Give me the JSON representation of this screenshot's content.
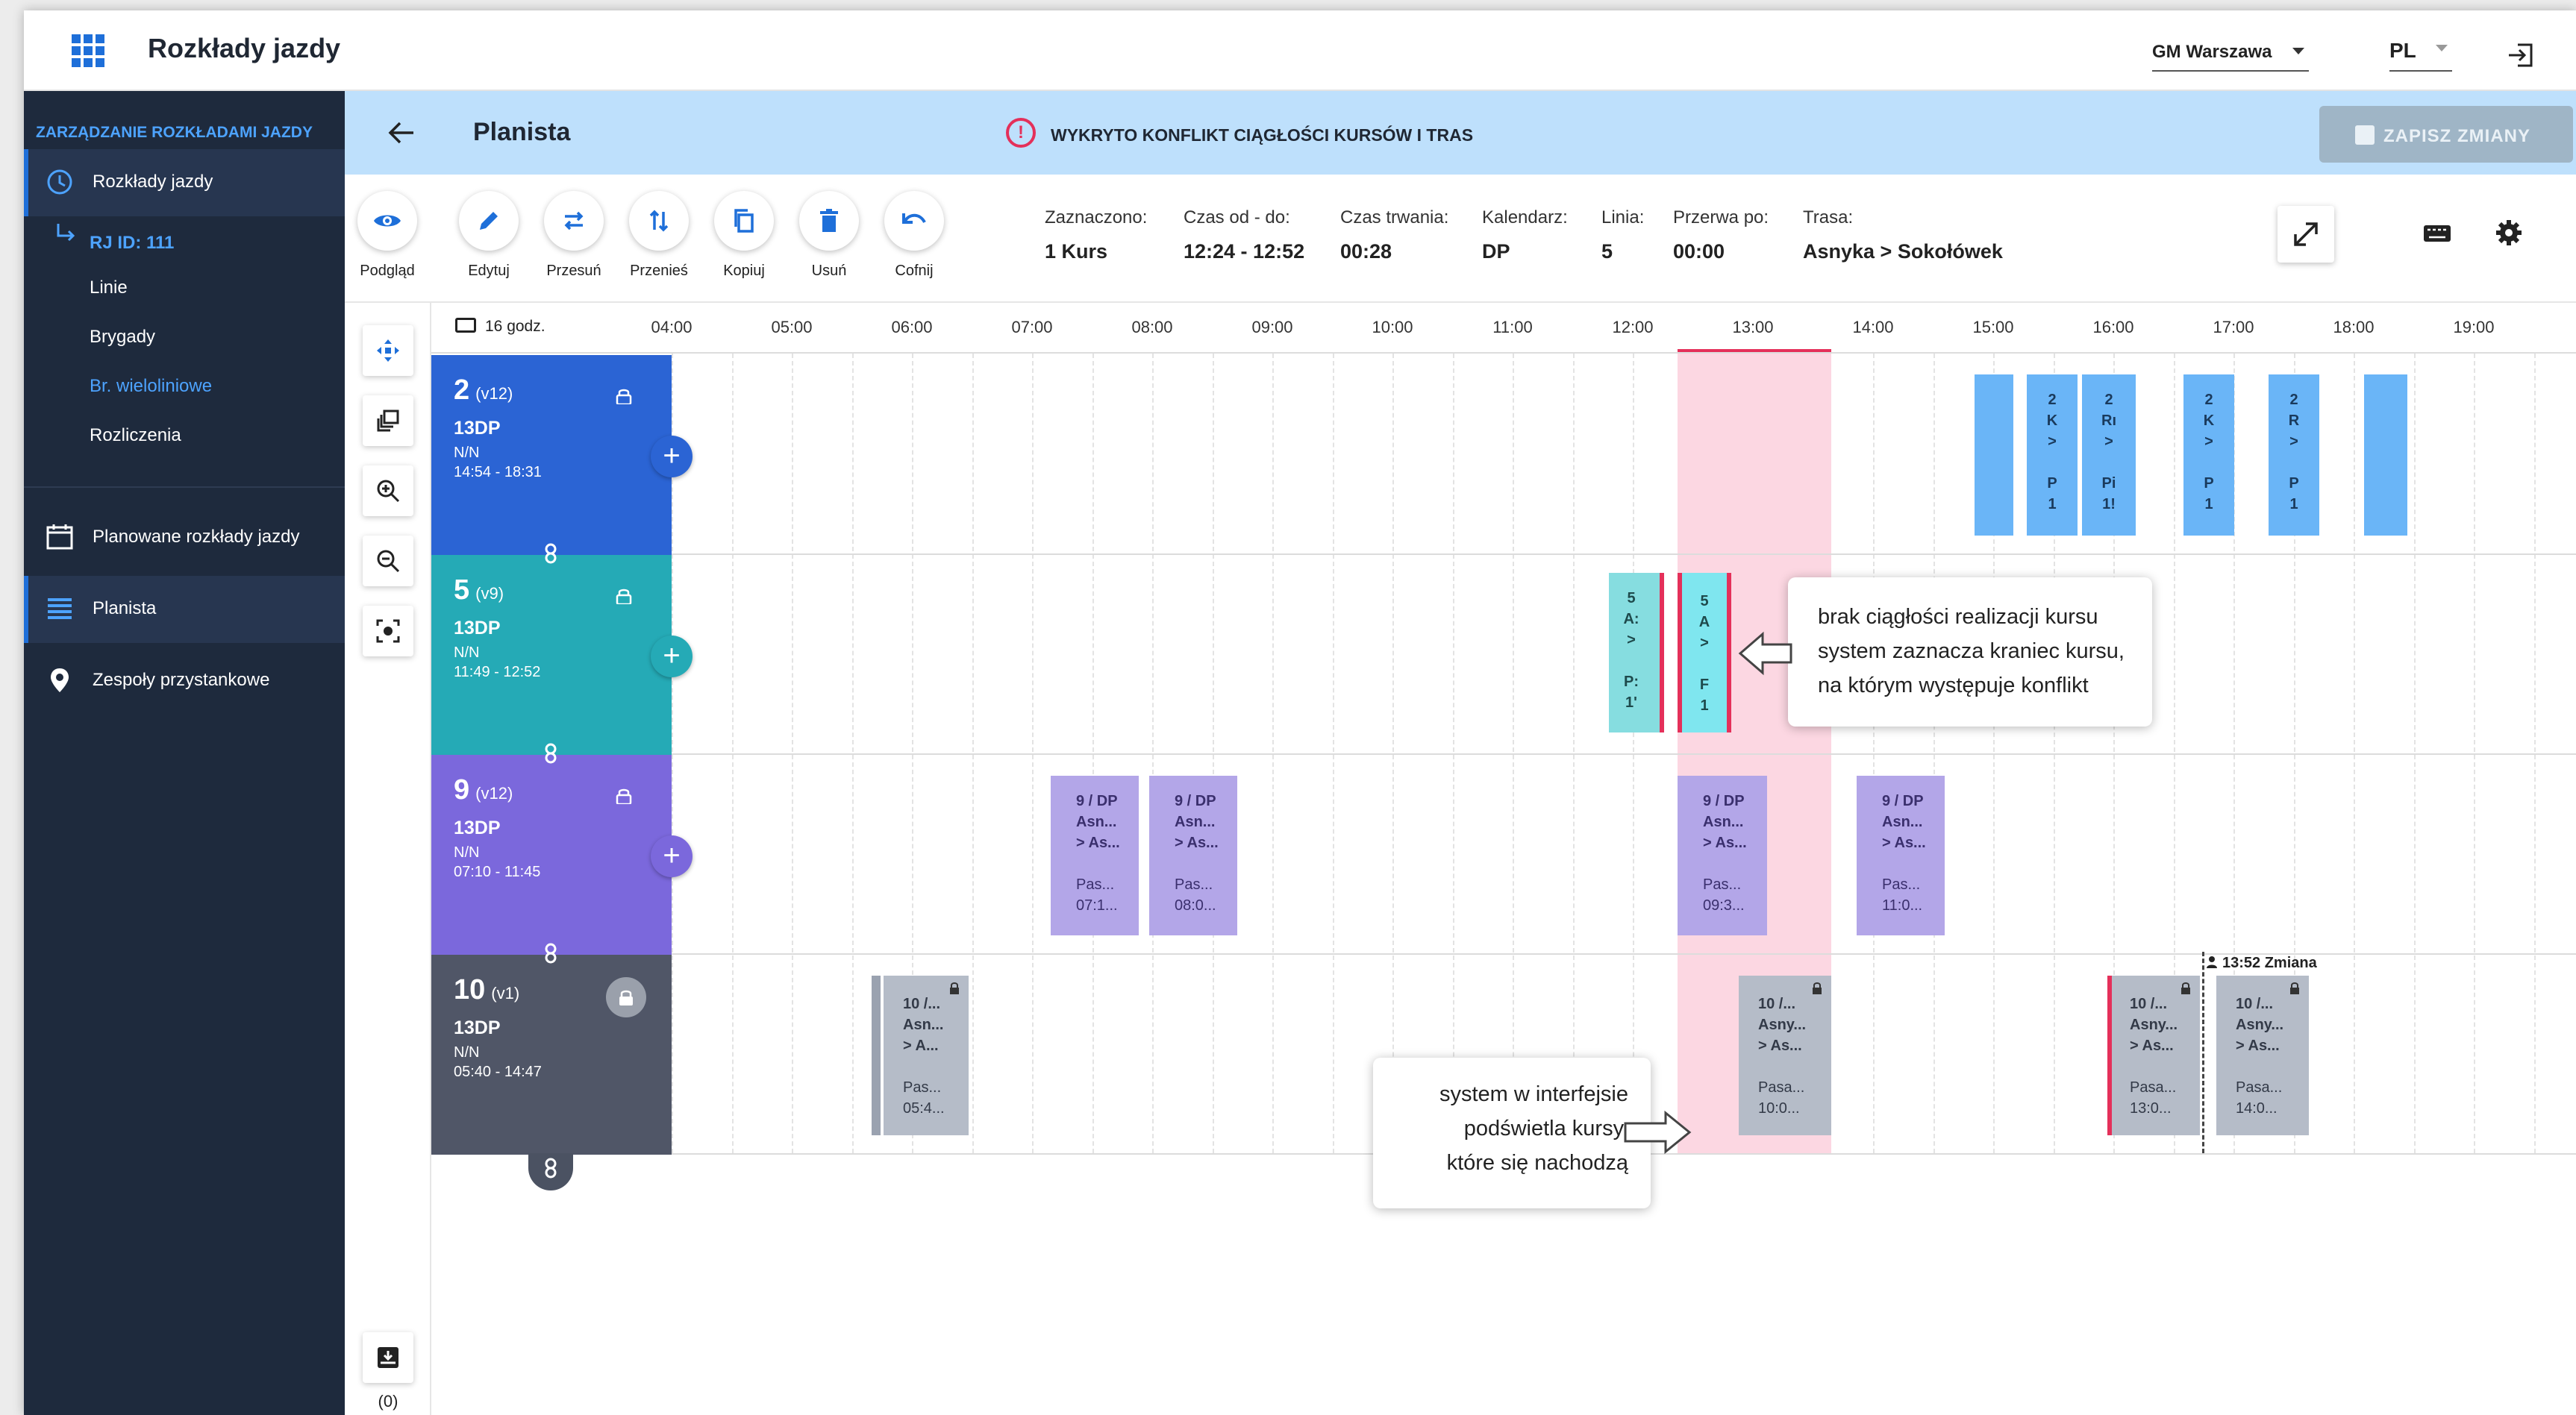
{
  "app": {
    "title": "Rozkłady jazdy"
  },
  "topbar": {
    "org": "GM Warszawa",
    "lang": "PL"
  },
  "sidebar": {
    "heading": "ZARZĄDZANIE ROZKŁADAMI JAZDY",
    "items": [
      {
        "label": "Rozkłady jazdy",
        "icon": "clock-icon"
      },
      {
        "label": "Planowane rozkłady jazdy",
        "icon": "calendar-icon"
      },
      {
        "label": "Planista",
        "icon": "planner-icon"
      },
      {
        "label": "Zespoły przystankowe",
        "icon": "pin-icon"
      }
    ],
    "rj": "RJ ID: 111",
    "subitems": [
      {
        "label": "Linie"
      },
      {
        "label": "Brygady"
      },
      {
        "label": "Br. wieloliniowe"
      },
      {
        "label": "Rozliczenia"
      }
    ]
  },
  "header": {
    "title": "Planista",
    "conflict": "WYKRYTO KONFLIKT CIĄGŁOŚCI KURSÓW I TRAS",
    "save": "ZAPISZ ZMIANY"
  },
  "toolbar": {
    "buttons": [
      {
        "label": "Podgląd",
        "icon": "eye-icon"
      },
      {
        "label": "Edytuj",
        "icon": "pencil-icon"
      },
      {
        "label": "Przesuń",
        "icon": "swap-horizontal-icon"
      },
      {
        "label": "Przenieś",
        "icon": "swap-vertical-icon"
      },
      {
        "label": "Kopiuj",
        "icon": "copy-icon"
      },
      {
        "label": "Usuń",
        "icon": "trash-icon"
      },
      {
        "label": "Cofnij",
        "icon": "undo-icon"
      }
    ],
    "info": [
      {
        "key": "Zaznaczono:",
        "value": "1 Kurs"
      },
      {
        "key": "Czas od - do:",
        "value": "12:24 - 12:52"
      },
      {
        "key": "Czas trwania:",
        "value": "00:28"
      },
      {
        "key": "Kalendarz:",
        "value": "DP"
      },
      {
        "key": "Linia:",
        "value": "5"
      },
      {
        "key": "Przerwa po:",
        "value": "00:00"
      },
      {
        "key": "Trasa:",
        "value": "Asnyka > Sokołówek"
      }
    ]
  },
  "toolcol": {
    "count": "(0)"
  },
  "gantt": {
    "hours_label": "16 godz.",
    "ticks": [
      "04:00",
      "05:00",
      "06:00",
      "07:00",
      "08:00",
      "09:00",
      "10:00",
      "11:00",
      "12:00",
      "13:00",
      "14:00",
      "15:00",
      "16:00",
      "17:00",
      "18:00",
      "19:00"
    ],
    "vehicles": [
      {
        "num": "2",
        "ver": "(v12)",
        "code": "13DP",
        "nn": "N/N",
        "time": "14:54 - 18:31",
        "color": "#2b64d4"
      },
      {
        "num": "5",
        "ver": "(v9)",
        "code": "13DP",
        "nn": "N/N",
        "time": "11:49 - 12:52",
        "color": "#25aab6"
      },
      {
        "num": "9",
        "ver": "(v12)",
        "code": "13DP",
        "nn": "N/N",
        "time": "07:10 - 11:45",
        "color": "#7b68dc"
      },
      {
        "num": "10",
        "ver": "(v1)",
        "code": "13DP",
        "nn": "N/N",
        "time": "05:40 - 14:47",
        "color": "#505667"
      }
    ],
    "purple_trips": [
      {
        "l1": "9 / DP",
        "l2": "Asn...",
        "l3": "> As...",
        "l4": "Pas...",
        "l5": "07:1..."
      },
      {
        "l1": "9 / DP",
        "l2": "Asn...",
        "l3": "> As...",
        "l4": "Pas...",
        "l5": "08:0..."
      },
      {
        "l1": "9 / DP",
        "l2": "Asn...",
        "l3": "> As...",
        "l4": "Pas...",
        "l5": "09:3..."
      },
      {
        "l1": "9 / DP",
        "l2": "Asn...",
        "l3": "> As...",
        "l4": "Pas...",
        "l5": "11:0..."
      }
    ],
    "gray_trips": [
      {
        "l1": "10 /...",
        "l2": "Asn...",
        "l3": "> A...",
        "l4": "Pas...",
        "l5": "05:4..."
      },
      {
        "l1": "10 /...",
        "l2": "Asny...",
        "l3": "> As...",
        "l4": "Pasa...",
        "l5": "10:0..."
      },
      {
        "l1": "10 /...",
        "l2": "Asny...",
        "l3": "> As...",
        "l4": "Pasa...",
        "l5": "13:0..."
      },
      {
        "l1": "10 /...",
        "l2": "Asny...",
        "l3": "> As...",
        "l4": "Pasa...",
        "l5": "14:0..."
      }
    ],
    "blue_trips": [
      {
        "lines": []
      },
      {
        "lines": [
          "2",
          "K",
          ">",
          "",
          "P",
          "1"
        ]
      },
      {
        "lines": [
          "2",
          "Rı",
          ">",
          "",
          "Pi",
          "1!"
        ]
      },
      {
        "lines": [
          "2",
          "K",
          ">",
          "",
          "P",
          "1"
        ]
      },
      {
        "lines": [
          "2",
          "R",
          ">",
          "",
          "P",
          "1"
        ]
      },
      {
        "lines": []
      }
    ],
    "teal_trips": [
      {
        "lines": [
          "5",
          "A:",
          ">",
          "",
          "P:",
          "1'"
        ]
      },
      {
        "lines": [
          "5",
          "A",
          ">",
          "F",
          "1"
        ]
      }
    ],
    "change_label": "13:52 Zmiana",
    "callouts": {
      "top": [
        "brak ciągłości realizacji kursu",
        "system zaznacza kraniec kursu,",
        "na którym występuje konflikt"
      ],
      "bottom": [
        "system w interfejsie",
        "podświetla kursy,",
        "które się nachodzą"
      ]
    }
  }
}
